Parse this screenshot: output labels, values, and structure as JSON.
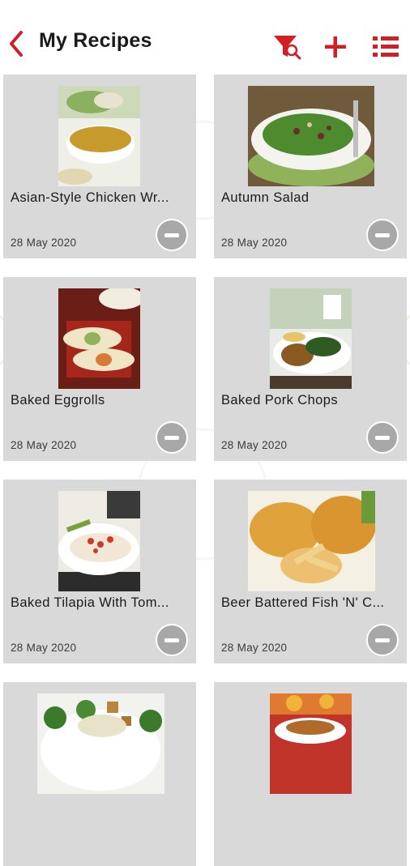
{
  "header": {
    "title": "My Recipes",
    "icons": [
      "back-chevron-icon",
      "filter-search-icon",
      "plus-icon",
      "list-icon"
    ],
    "accent_color": "#d21f26"
  },
  "recipes": [
    {
      "title": "Asian-Style Chicken Wr...",
      "date": "28 May 2020"
    },
    {
      "title": "Autumn Salad",
      "date": "28 May 2020"
    },
    {
      "title": "Baked Eggrolls",
      "date": "28 May 2020"
    },
    {
      "title": "Baked Pork Chops",
      "date": "28 May 2020"
    },
    {
      "title": "Baked Tilapia With Tom...",
      "date": "28 May 2020"
    },
    {
      "title": "Beer Battered Fish 'N' C...",
      "date": "28 May 2020"
    },
    {
      "title": "",
      "date": ""
    },
    {
      "title": "",
      "date": ""
    }
  ]
}
